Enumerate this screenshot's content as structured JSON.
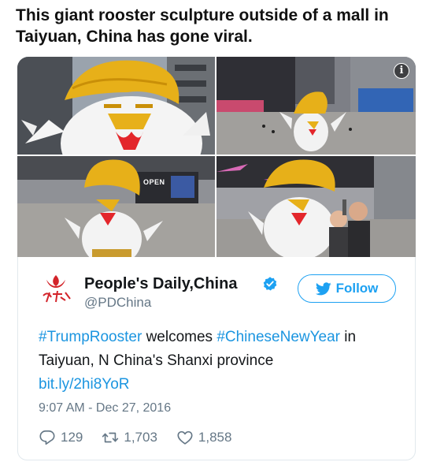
{
  "headline": "This giant rooster sculpture outside of a mall in Taiyuan, China has gone viral.",
  "photos": {
    "info_icon": "i",
    "sign_open": "OPEN"
  },
  "tweet": {
    "display_name": "People's Daily,China",
    "handle": "@PDChina",
    "follow_label": "Follow",
    "text_parts": {
      "hashtag1": "#TrumpRooster",
      "middle": " welcomes ",
      "hashtag2": "#ChineseNewYear",
      "tail": " in Taiyuan, N China's Shanxi province",
      "link": "bit.ly/2hi8YoR"
    },
    "timestamp": "9:07 AM - Dec 27, 2016",
    "replies": "129",
    "retweets": "1,703",
    "likes": "1,858"
  },
  "colors": {
    "twitter_blue": "#1da1f2",
    "link_blue": "#1b95e0",
    "muted_gray": "#657786",
    "gold": "#e7b019",
    "comb_red": "#e3262b"
  },
  "icons": [
    "info-icon",
    "verified-icon",
    "twitter-bird-icon",
    "reply-icon",
    "retweet-icon",
    "like-icon",
    "peoples-daily-logo"
  ]
}
